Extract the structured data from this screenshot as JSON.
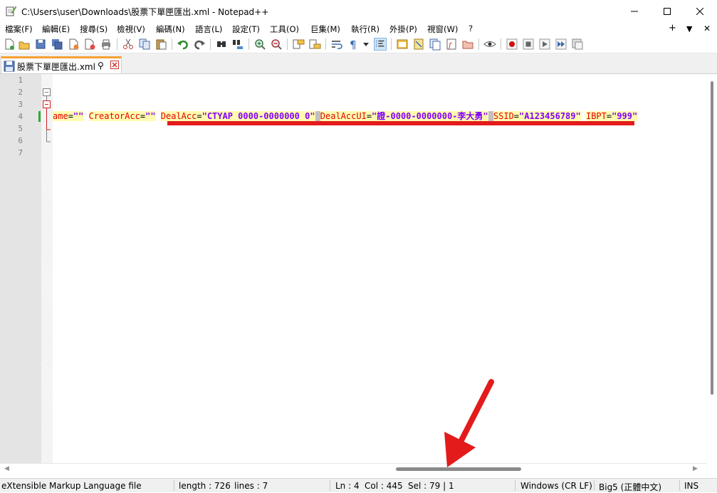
{
  "window": {
    "title": "C:\\Users\\user\\Downloads\\股票下單匣匯出.xml - Notepad++"
  },
  "menu": {
    "items": [
      "檔案(F)",
      "編輯(E)",
      "搜尋(S)",
      "檢視(V)",
      "編碼(N)",
      "語言(L)",
      "設定(T)",
      "工具(O)",
      "巨集(M)",
      "執行(R)",
      "外掛(P)",
      "視窗(W)",
      "?"
    ],
    "right": [
      "+",
      "▼",
      "✕"
    ]
  },
  "toolbar": {
    "icons": [
      "new-file-icon",
      "open-file-icon",
      "save-icon",
      "save-all-icon",
      "close-icon",
      "close-all-icon",
      "print-icon",
      "cut-icon",
      "copy-icon",
      "paste-icon",
      "undo-icon",
      "redo-icon",
      "find-icon",
      "replace-icon",
      "zoom-in-icon",
      "zoom-out-icon",
      "sync-v-icon",
      "sync-h-icon",
      "word-wrap-icon",
      "show-all-chars-icon",
      "dropdown-icon",
      "indent-guide-icon",
      "udl-icon",
      "doc-map-icon",
      "doc-list-icon",
      "function-list-icon",
      "folder-workspace-icon",
      "monitor-icon",
      "record-macro-icon",
      "stop-macro-icon",
      "play-macro-icon",
      "run-macro-multiple-icon",
      "save-macro-icon"
    ]
  },
  "tab": {
    "label": "股票下單匣匯出.xml",
    "pin": "⚲"
  },
  "editor": {
    "line_numbers": [
      "1",
      "2",
      "3",
      "4",
      "5",
      "6",
      "7"
    ],
    "code_line": {
      "seg1_attr": "ame",
      "seg1_eq": "=",
      "seg1_val": "\"\"",
      "seg2_attr": "CreatorAcc",
      "seg2_eq": "=",
      "seg2_val": "\"\"",
      "seg3_attr": "DealAcc",
      "seg3_eq": "=",
      "seg3_val": "\"CTYAP 0000-0000000 0\"",
      "seg4_attr": "DealAccUI",
      "seg4_eq": "=",
      "seg4_val": "\"證-0000-0000000-李大勇\"",
      "seg5_attr": "SSID",
      "seg5_eq": "=",
      "seg5_val": "\"A123456789\"",
      "seg6_attr": "IBPT",
      "seg6_eq": "=",
      "seg6_val": "\"999\""
    }
  },
  "statusbar": {
    "language": "eXtensible Markup Language file",
    "length": "length : 726",
    "lines": "lines : 7",
    "ln": "Ln : 4",
    "col": "Col : 445",
    "sel": "Sel : 79 | 1",
    "eol": "Windows (CR LF)",
    "encoding": "Big5 (正體中文)",
    "mode": "INS"
  },
  "colors": {
    "attr": "#e60000",
    "value": "#8000ff",
    "highlight": "#fffbb0",
    "selection": "#c0c0c0",
    "annotation_red": "#e31b1b",
    "tab_accent": "#f7a032"
  }
}
